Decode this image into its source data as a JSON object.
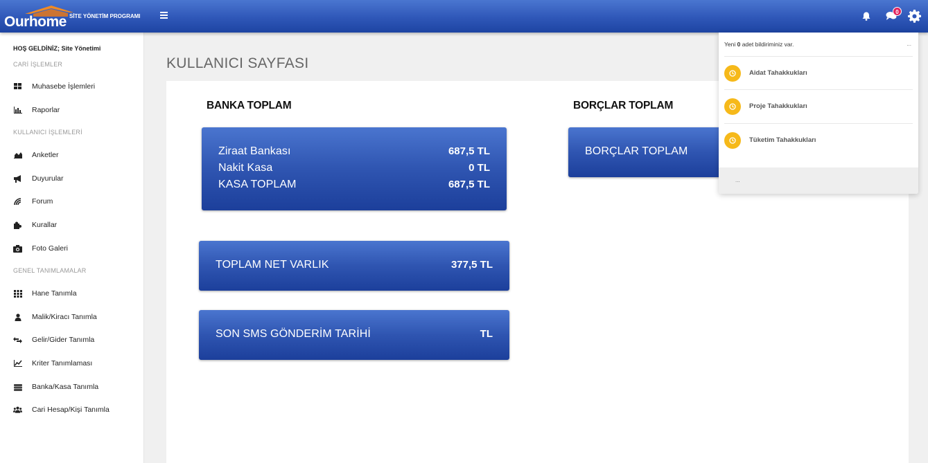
{
  "header": {
    "logo_text": "Ourhome",
    "logo_subtitle": "SİTE YÖNETİM PROGRAMI",
    "messages_badge": "0",
    "colors": {
      "bar": "#2f57b8",
      "badge": "#e0245e"
    }
  },
  "sidebar": {
    "welcome": "HOŞ GELDİNİZ; Site Yönetimi",
    "sections": {
      "cari": "CARİ İŞLEMLER",
      "kullanici": "KULLANICI İŞLEMLERİ",
      "genel": "GENEL TANIMLAMALAR"
    },
    "items": [
      {
        "label": "Muhasebe İşlemleri",
        "icon": "grid-small-icon"
      },
      {
        "label": "Raporlar",
        "icon": "bar-chart-icon"
      },
      {
        "label": "Anketler",
        "icon": "area-chart-icon"
      },
      {
        "label": "Duyurular",
        "icon": "bullhorn-icon"
      },
      {
        "label": "Forum",
        "icon": "signal-icon"
      },
      {
        "label": "Kurallar",
        "icon": "puzzle-icon"
      },
      {
        "label": "Foto Galeri",
        "icon": "camera-icon"
      },
      {
        "label": "Hane Tanımla",
        "icon": "grid-icon"
      },
      {
        "label": "Malik/Kiracı Tanımla",
        "icon": "user-icon"
      },
      {
        "label": "Gelir/Gider Tanımla",
        "icon": "exchange-icon"
      },
      {
        "label": "Kriter Tanımlaması",
        "icon": "line-chart-icon"
      },
      {
        "label": "Banka/Kasa Tanımla",
        "icon": "money-icon"
      },
      {
        "label": "Cari Hesap/Kişi Tanımla",
        "icon": "users-icon"
      }
    ]
  },
  "main": {
    "page_title": "KULLANICI SAYFASI",
    "banka_title": "BANKA TOPLAM",
    "borclar_title": "BORÇLAR TOPLAM",
    "banka_rows": [
      {
        "label": "Ziraat Bankası",
        "value": "687,5 TL"
      },
      {
        "label": "Nakit Kasa",
        "value": "0 TL"
      },
      {
        "label": "KASA TOPLAM",
        "value": "687,5 TL"
      }
    ],
    "borclar_label": "BORÇLAR TOPLAM",
    "net_varlik": {
      "label": "TOPLAM NET VARLIK",
      "value": "377,5 TL"
    },
    "sms": {
      "label": "SON SMS GÖNDERİM TARİHİ",
      "value": "TL"
    }
  },
  "notifications": {
    "prefix": "Yeni ",
    "count": "0",
    "suffix": " adet bildiriminiz var.",
    "more": "...",
    "items": [
      {
        "label": "Aidat Tahakkukları",
        "icon": "clock-icon"
      },
      {
        "label": "Proje Tahakkukları",
        "icon": "clock-icon"
      },
      {
        "label": "Tüketim Tahakkukları",
        "icon": "clock-icon"
      }
    ],
    "footer": "..."
  }
}
